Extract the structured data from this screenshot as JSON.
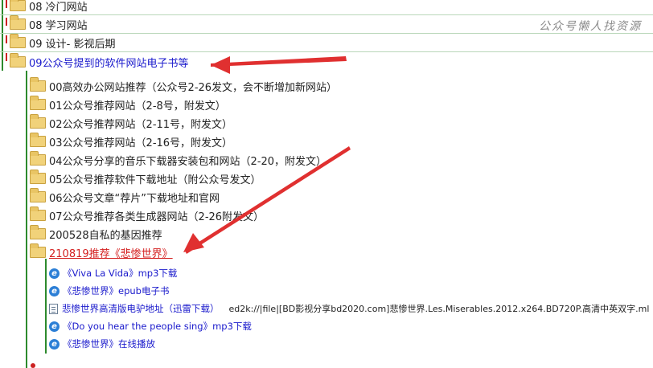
{
  "watermark": "公众号懒人找资源",
  "top_folders": [
    {
      "label": "08 冷门网站"
    },
    {
      "label": "08 学习网站"
    },
    {
      "label": "09 设计- 影视后期"
    },
    {
      "label": "09公众号提到的软件网站电子书等"
    }
  ],
  "sub_folders": [
    {
      "label": "00高效办公网站推荐（公众号2-26发文，会不断增加新网站）"
    },
    {
      "label": "01公众号推荐网站（2-8号，附发文）"
    },
    {
      "label": "02公众号推荐网站（2-11号，附发文）"
    },
    {
      "label": "03公众号推荐网站（2-16号，附发文）"
    },
    {
      "label": "04公众号分享的音乐下载器安装包和网站（2-20，附发文）"
    },
    {
      "label": "05公众号推荐软件下载地址（附公众号发文）"
    },
    {
      "label": "06公众号文章“荐片”下载地址和官网"
    },
    {
      "label": "07公众号推荐各类生成器网站（2-26附发文）"
    },
    {
      "label": "200528自私的基因推荐"
    },
    {
      "label": "210819推荐《悲惨世界》"
    }
  ],
  "links": [
    {
      "icon": "ie-icon",
      "label": "《Viva La Vida》mp3下载",
      "extra": ""
    },
    {
      "icon": "ie-icon",
      "label": "《悲惨世界》epub电子书",
      "extra": ""
    },
    {
      "icon": "doc-icon",
      "label": "悲惨世界高清版电驴地址（迅雷下载）",
      "extra": "ed2k://|file|[BD影视分享bd2020.com]悲惨世界.Les.Miserables.2012.x264.BD720P.高清中英双字.ml"
    },
    {
      "icon": "ie-icon",
      "label": "《Do you hear the people sing》mp3下载",
      "extra": ""
    },
    {
      "icon": "ie-icon",
      "label": "《悲惨世界》在线播放",
      "extra": ""
    }
  ],
  "colors": {
    "tree_line": "#2d8a2d",
    "arrow": "#e03030",
    "highlight_blue": "#1a1acc",
    "highlight_red": "#d42020"
  }
}
